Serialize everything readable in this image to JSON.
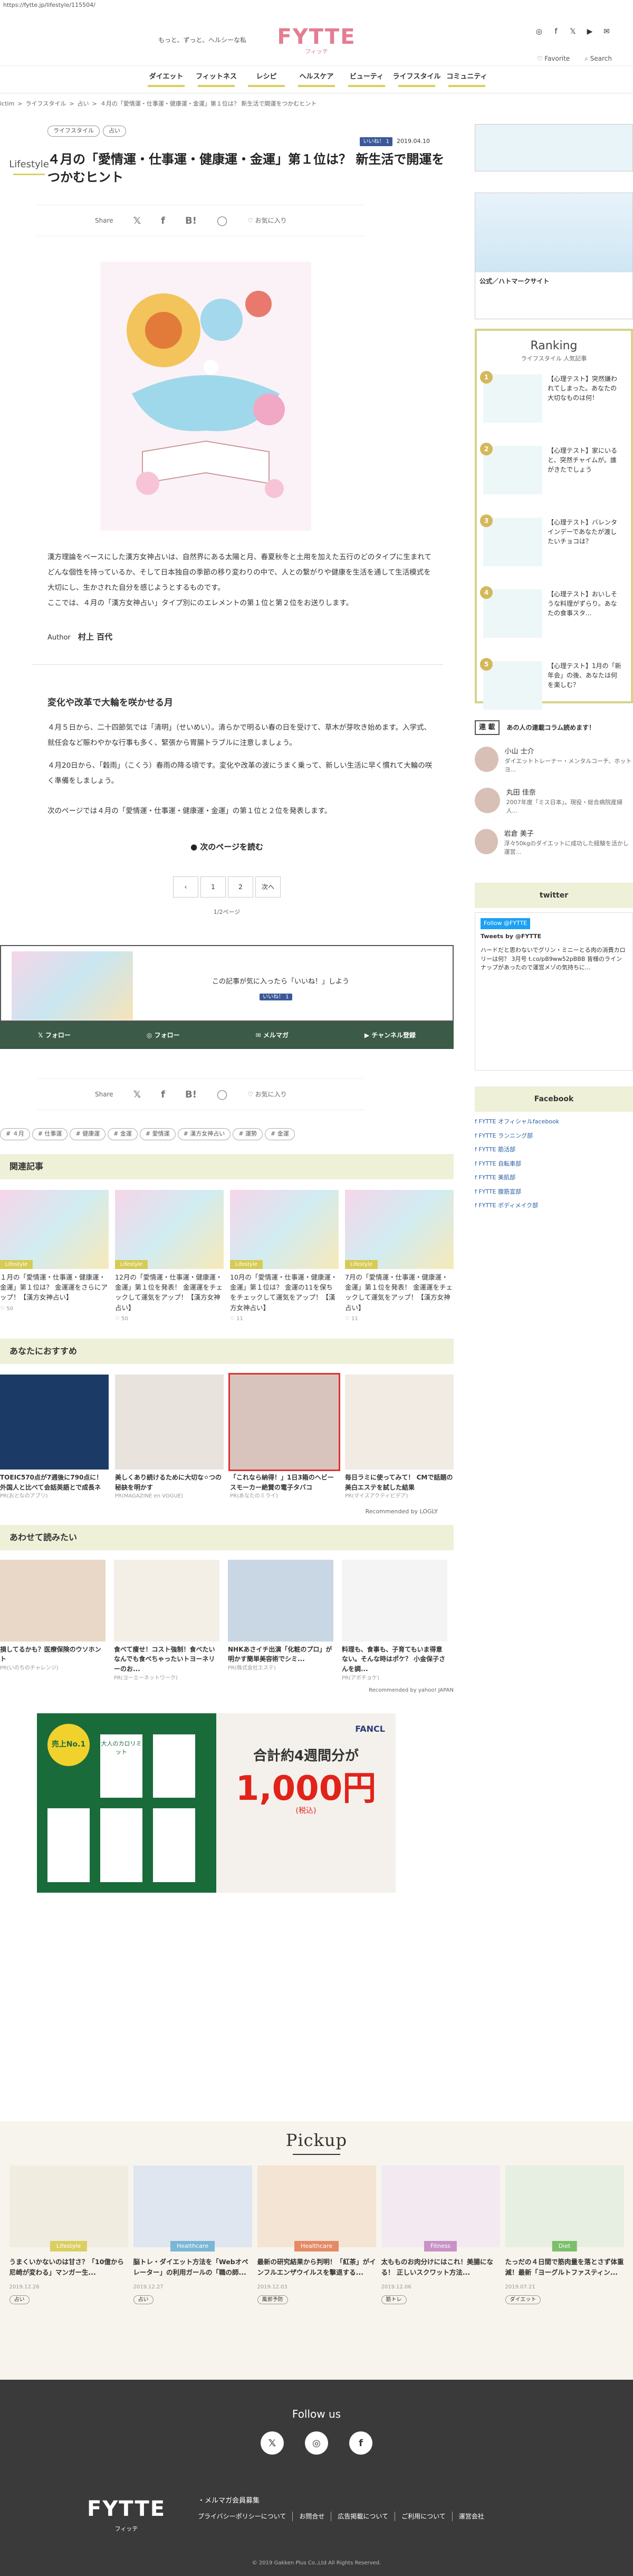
{
  "url": "https://fytte.jp/lifestyle/115504/",
  "site": {
    "tagline": "もっと、ずっと、ヘルシーな私",
    "logo": "FYTTE",
    "logo_sub": "フィッテ",
    "favorite": "Favorite",
    "search": "Search"
  },
  "nav": [
    {
      "label": "ダイエット",
      "color": "#d9cf5f"
    },
    {
      "label": "フィットネス",
      "color": "#d9cf5f"
    },
    {
      "label": "レシピ",
      "color": "#d9cf5f"
    },
    {
      "label": "ヘルスケア",
      "color": "#d9cf5f"
    },
    {
      "label": "ビューティ",
      "color": "#d9cf5f"
    },
    {
      "label": "ライフスタイル",
      "color": "#d9cf5f"
    },
    {
      "label": "コミュニティ",
      "color": "#d9cf5f"
    }
  ],
  "breadcrumb": [
    "ictim",
    "ライフスタイル",
    "占い",
    "４月の「愛情運・仕事運・健康運・金運」第１位は？ 新生活で開運をつかむヒント"
  ],
  "article": {
    "category": "Lifestyle",
    "tags": [
      "ライフスタイル",
      "占い"
    ],
    "like_label": "いいね！ 1",
    "date": "2019.04.10",
    "title": "４月の「愛情運・仕事運・健康運・金運」第１位は？ 新生活で開運をつかむヒント",
    "share_label": "Share",
    "fav_label": "お気に入り",
    "paragraphs": [
      "漢方理論をベースにした漢方女神占いは、自然界にある太陽と月、春夏秋冬と土用を加えた五行のどのタイプに生まれてどんな個性を持っているか、そして日本独自の季節の移り変わりの中で、人との繋がりや健康を生活を通して生活模式を大切にし、生かされた自分を感じようとするものです。",
      "ここでは、４月の「漢方女神占い」タイプ別にのエレメントの第１位と第２位をお送りします。"
    ],
    "author_label": "Author",
    "author": "村上 百代",
    "section_title": "変化や改革で大輪を咲かせる月",
    "paragraphs2": [
      "４月５日から、二十四節気では「清明」（せいめい）。清らかで明るい春の日を受けて、草木が芽吹き始めます。入学式、就任会など賑わやかな行事も多く、緊張から胃腸トラブルに注意しましょう。",
      "４月20日から、「穀雨」（こくう）春雨の降る頃です。変化や改革の波にうまく乗って、新しい生活に早く慣れて大輪の咲く準備をしましょう。",
      "次のページでは４月の「愛情運・仕事運・健康運・金運」の第１位と２位を発表します。"
    ],
    "next_page": "次のページを読む",
    "pager": [
      "‹",
      "1",
      "2",
      "次へ"
    ],
    "pageinfo": "1/2ページ",
    "like_prompt": "この記事が気に入ったら「いいね！」しよう",
    "follow": [
      "フォロー",
      "フォロー",
      "メルマガ",
      "チャンネル登録"
    ],
    "keywords": [
      "４月",
      "仕事運",
      "健康運",
      "金運",
      "愛情運",
      "漢方女神占い",
      "運勢",
      "金運"
    ]
  },
  "related": {
    "title": "関連記事",
    "items": [
      {
        "title": "１月の「愛情運・仕事運・健康運・金運」第１位は？ 金運運をさらにアップ！【漢方女神占い】",
        "meta": "50",
        "badge": "Lifestyle"
      },
      {
        "title": "12月の「愛情運・仕事運・健康運・金運」第１位を発表！ 金運運をチェックして運気をアップ！【漢方女神占い】",
        "meta": "50",
        "badge": "Lifestyle"
      },
      {
        "title": "10月の「愛情運・仕事運・健康運・金運」第１位は？ 金運の11を保ちをチェックして運気をアップ！【漢方女神占い】",
        "meta": "11",
        "badge": "Lifestyle"
      },
      {
        "title": "7月の「愛情運・仕事運・健康運・金運」第１位を発表！ 金運運をチェックして運気をアップ！【漢方女神占い】",
        "meta": "11",
        "badge": "Lifestyle"
      }
    ]
  },
  "recommend": {
    "title": "あなたにおすすめ",
    "items": [
      {
        "title": "TOEIC570点が7週後に790点に！外国人と比べて会話英語とで成長ネ",
        "brand": "PR(おとなのアプリ)"
      },
      {
        "title": "美しくあり続けるために大切な⚪︎つの秘訣を明かす",
        "brand": "PR(MAGAZINE en VOGUE)"
      },
      {
        "title": "「これなら納得！」1日3箱のヘビースモーカー絶賛の電子タバコ",
        "brand": "PR(あなたのミライ)"
      },
      {
        "title": "毎日ラミに使ってみて！ CMで話題の美白エステを試した結果",
        "brand": "PR(マイスアクティビデア)"
      }
    ],
    "powered": "Recommended by LOGLY"
  },
  "also": {
    "title": "あわせて読みたい",
    "items": [
      {
        "title": "損してるかも？医療保険のウソホント",
        "brand": "PR(いのちのチャレンジ)"
      },
      {
        "title": "食べて痩せ！コスト強制！食べたいなんでも食べちゃったいトヨーネリーのお...",
        "brand": "PR(ヨーエーネットワーク)"
      },
      {
        "title": "NHKあさイチ出演「化粧のプロ」が明かす簡単美容術でシミ...",
        "brand": "PR(株式会社エステ)"
      },
      {
        "title": "料理も、食事も、子育てもいま得意ない。そんな時はポケ？ 小金保子さんを調...",
        "brand": "PR(アボチョケ)"
      }
    ],
    "powered": "Recommended by yahoo! JAPAN"
  },
  "banner": {
    "brand": "FANCL",
    "headline": "合計約4週間分が",
    "price": "1,000円",
    "price_note": "(税込)",
    "left_badge": "売上No.1",
    "product": "大人のカロリミット"
  },
  "pickup": {
    "title": "Pickup",
    "items": [
      {
        "cat": "Lifestyle",
        "color": "#d9cf5f",
        "title": "うまくいかないのは甘さ？「10億から尼崎が変わる」マンガー生...",
        "date": "2019.12.26",
        "kw": "占い"
      },
      {
        "cat": "Healthcare",
        "color": "#7ab6d6",
        "title": "脳トレ・ダイエット方法を「Webオペレーター」の利用ガールの「職の師...",
        "date": "2019.12.27",
        "kw": "占い"
      },
      {
        "cat": "Healthcare",
        "color": "#e58a67",
        "title": "最新の研究結果から判明！「紅茶」がインフルエンザウイルスを撃退する...",
        "date": "2019.12.03",
        "kw": "風邪予防"
      },
      {
        "cat": "Fitness",
        "color": "#c793c5",
        "title": "太もものお肉分けにはこれ！美腸になる！ 正しいスクワット方法...",
        "date": "2019.12.06",
        "kw": "筋トレ"
      },
      {
        "cat": "Diet",
        "color": "#7bbf6a",
        "title": "たっだの４日間で筋肉量を落とさず体重減！最新「ヨーグルトファスティン...",
        "date": "2019.07.21",
        "kw": "ダイエット"
      }
    ]
  },
  "sidebar": {
    "ad1": "公式／ハトマークサイト",
    "ranking_title": "Ranking",
    "ranking_sub": "ライフスタイル 人気記事",
    "ranking": [
      "【心理テスト】突然嫌われてしまった。あなたの大切なものは何！",
      "【心理テスト】家にいると、突然チャイムが。誰がきたでしょう",
      "【心理テスト】バレンタインデーであなたが渡したいチョコは？",
      "【心理テスト】おいしそうな料理がずらり。あなたの食事スタ...",
      "【心理テスト】1月の「新年会」の後、あなたは何を楽しむ？"
    ],
    "serial_label": "連 載",
    "serial_title": "あの人の連載コラム読めます！",
    "writers": [
      {
        "name": "小山 士介",
        "desc": "ダイエットトレーナー・メンタルコーチ、ホットヨ..."
      },
      {
        "name": "丸田 佳奈",
        "desc": "2007年度「ミス日本」。現役・総合病院産婦人..."
      },
      {
        "name": "岩倉 美子",
        "desc": "浮々50kgのダイエットに成功した経験を活かし運営..."
      }
    ],
    "twitter": "twitter",
    "tweets_by": "Tweets by @FYTTE",
    "tweet_text": "ハードだと思わないでグリン・ミニーとる肉の消費カロリーは何？ 3月号 t.co/pB9ww52pBBB 皆様のラインナップがあったので運営メゾの気持ちに...",
    "facebook": "Facebook",
    "fb_links": [
      "FYTTE オフィシャルfacebook",
      "FYTTE ランニング部",
      "FYTTE 筋活部",
      "FYTTE 自転車部",
      "FYTTE 美肌部",
      "FYTTE 腹筋宣部",
      "FYTTE ボディメイク部"
    ]
  },
  "footer": {
    "follow_us": "Follow us",
    "logo": "FYTTE",
    "logo_sub": "フィッテ",
    "mail": "・メルマガ会員募集",
    "links": [
      "プライバシーポリシーについて",
      "お問合せ",
      "広告掲載について",
      "ご利用について",
      "運営会社"
    ],
    "copyright": "© 2019 Gakken Plus Co.,Ltd All Rights Reserved."
  }
}
